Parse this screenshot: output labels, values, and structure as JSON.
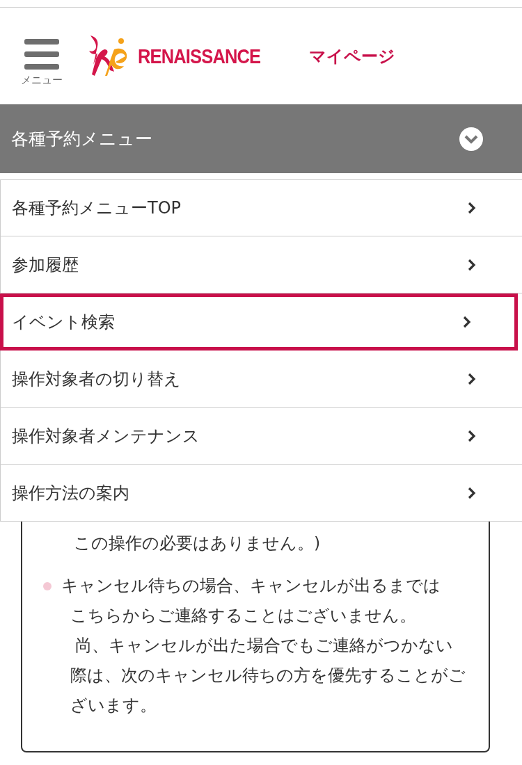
{
  "header": {
    "menu_label": "メニュー",
    "brand": "RENAISSANCE",
    "page_title": "マイページ"
  },
  "accordion": {
    "title": "各種予約メニュー",
    "expanded": true,
    "items": [
      {
        "label": "各種予約メニューTOP",
        "selected": false
      },
      {
        "label": "参加履歴",
        "selected": false
      },
      {
        "label": "イベント検索",
        "selected": true
      },
      {
        "label": "操作対象者の切り替え",
        "selected": false
      },
      {
        "label": "操作対象者メンテナンス",
        "selected": false
      },
      {
        "label": "操作方法の案内",
        "selected": false
      }
    ]
  },
  "notice": {
    "items": [
      {
        "kind": "continuation",
        "lines": [
          "この操作の必要はありません。)"
        ]
      },
      {
        "kind": "bullet",
        "lines": [
          "キャンセル待ちの場合、キャンセルが出るまでは",
          "こちらからご連絡することはございません。",
          " 尚、キャンセルが出た場合でもご連絡がつかない際は、次のキャンセル待ちの方を優先することがございます。"
        ]
      }
    ]
  }
}
